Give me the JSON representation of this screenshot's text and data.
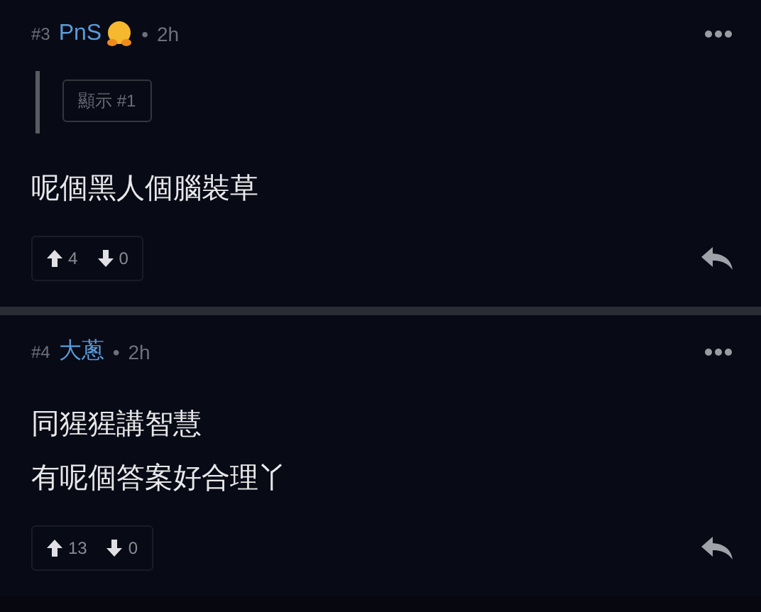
{
  "posts": [
    {
      "number": "#3",
      "username": "PnS",
      "has_emoji": true,
      "separator": "•",
      "time": "2h",
      "quote": "顯示 #1",
      "lines": [
        "呢個黑人個腦裝草"
      ],
      "upvotes": "4",
      "downvotes": "0"
    },
    {
      "number": "#4",
      "username": "大蔥",
      "has_emoji": false,
      "separator": "•",
      "time": "2h",
      "lines": [
        "同猩猩講智慧",
        "有呢個答案好合理丫"
      ],
      "upvotes": "13",
      "downvotes": "0"
    }
  ]
}
